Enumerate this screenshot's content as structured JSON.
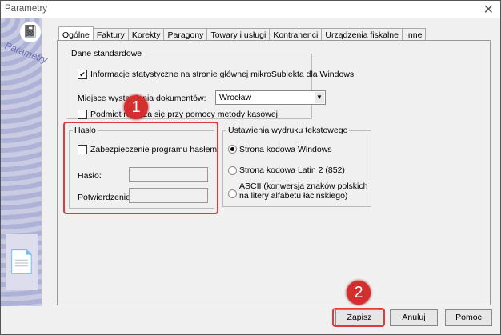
{
  "window": {
    "title": "Parametry",
    "close_icon": "close-icon"
  },
  "sidebar": {
    "brand": "Parametry"
  },
  "tabs": [
    "Ogólne",
    "Faktury",
    "Korekty",
    "Paragony",
    "Towary i usługi",
    "Kontrahenci",
    "Urządzenia fiskalne",
    "Inne"
  ],
  "active_tab": "Ogólne",
  "dane": {
    "legend": "Dane standardowe",
    "stat_label": "Informacje statystyczne na stronie głównej mikroSubiekta dla Windows",
    "stat_checked": true,
    "miejsce_label": "Miejsce wystawienia dokumentów:",
    "miejsce_value": "Wrocław",
    "kasowa_label": "Podmiot rozlicza się przy pomocy metody kasowej",
    "kasowa_checked": false
  },
  "haslo": {
    "legend": "Hasło",
    "zab_label": "Zabezpieczenie programu hasłem",
    "zab_checked": false,
    "haslo_label": "Hasło:",
    "haslo_value": "",
    "potw_label": "Potwierdzenie:",
    "potw_value": ""
  },
  "wydruk": {
    "legend": "Ustawienia wydruku tekstowego",
    "options": [
      "Strona kodowa Windows",
      "Strona kodowa Latin 2 (852)",
      "ASCII (konwersja znaków polskich",
      "na litery alfabetu łacińskiego)"
    ],
    "selected": "Strona kodowa Windows"
  },
  "buttons": {
    "save": "Zapisz",
    "cancel": "Anuluj",
    "help": "Pomoc"
  },
  "annotations": {
    "step1": "1",
    "step2": "2",
    "color": "#d32f2f"
  }
}
